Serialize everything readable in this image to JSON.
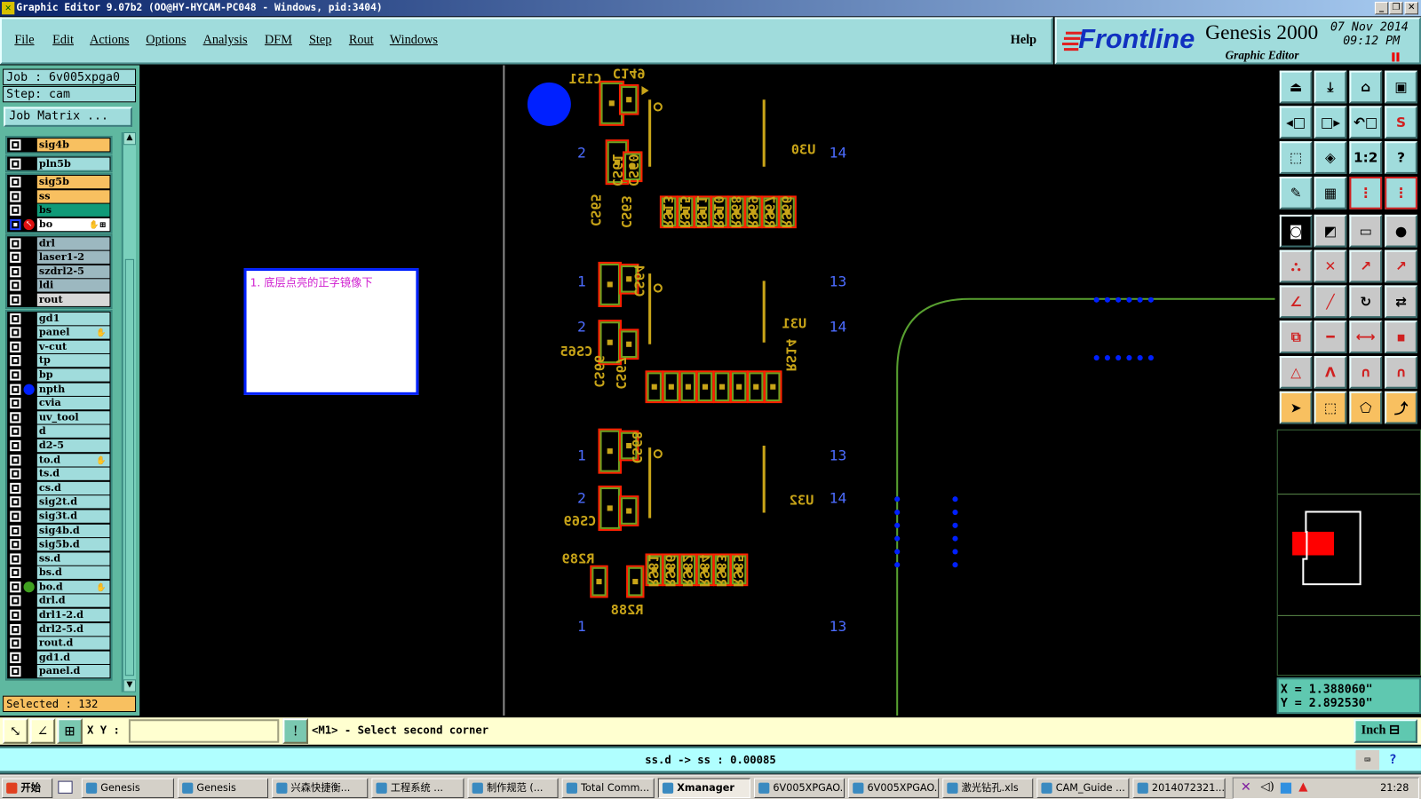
{
  "window": {
    "title": "Graphic Editor 9.07b2 (OO@HY-HYCAM-PC048 - Windows, pid:3404)",
    "min": "_",
    "max": "❐",
    "close": "✕"
  },
  "menu": {
    "items": [
      "File",
      "Edit",
      "Actions",
      "Options",
      "Analysis",
      "DFM",
      "Step",
      "Rout",
      "Windows"
    ],
    "help": "Help"
  },
  "brand": {
    "logo": "Frontline",
    "product": "Genesis 2000",
    "subtitle": "Graphic Editor",
    "date": "07 Nov 2014",
    "time": "09:12 PM"
  },
  "job": {
    "job": "Job  :  6v005xpga0",
    "step": "Step:  cam",
    "matrix_button": "Job Matrix ..."
  },
  "layer_groups": [
    [
      {
        "name": "sig4b",
        "color": "#f8c060"
      }
    ],
    [
      {
        "name": "pln5b",
        "color": "#a0dcdc"
      }
    ],
    [
      {
        "name": "sig5b",
        "color": "#f8c060"
      },
      {
        "name": "ss",
        "color": "#f8c060"
      },
      {
        "name": "bs",
        "color": "#109a78"
      },
      {
        "name": "bo",
        "color": "#ffffff",
        "work": true,
        "hand": "✋⊞"
      }
    ],
    [
      {
        "name": "drl",
        "color": "#9cb8c0"
      },
      {
        "name": "laser1-2",
        "color": "#9cb8c0"
      },
      {
        "name": "szdrl2-5",
        "color": "#9cb8c0"
      },
      {
        "name": "ldi",
        "color": "#9cb8c0"
      },
      {
        "name": "rout",
        "color": "#d8d8d8"
      }
    ],
    [
      {
        "name": "gd1",
        "color": "#a0dcdc"
      },
      {
        "name": "panel",
        "color": "#a0dcdc",
        "hand": "✋"
      },
      {
        "name": "v-cut",
        "color": "#a0dcdc"
      },
      {
        "name": "tp",
        "color": "#a0dcdc"
      },
      {
        "name": "bp",
        "color": "#a0dcdc"
      },
      {
        "name": "npth",
        "color": "#a0dcdc",
        "marker": "#0020ff"
      },
      {
        "name": "cvia",
        "color": "#a0dcdc"
      },
      {
        "name": "uv_tool",
        "color": "#a0dcdc"
      },
      {
        "name": "d",
        "color": "#a0dcdc"
      },
      {
        "name": "d2-5",
        "color": "#a0dcdc"
      },
      {
        "name": "to.d",
        "color": "#a0dcdc",
        "hand": "✋"
      },
      {
        "name": "ts.d",
        "color": "#a0dcdc"
      },
      {
        "name": "cs.d",
        "color": "#a0dcdc"
      },
      {
        "name": "sig2t.d",
        "color": "#a0dcdc"
      },
      {
        "name": "sig3t.d",
        "color": "#a0dcdc"
      },
      {
        "name": "sig4b.d",
        "color": "#a0dcdc"
      },
      {
        "name": "sig5b.d",
        "color": "#a0dcdc"
      },
      {
        "name": "ss.d",
        "color": "#a0dcdc"
      },
      {
        "name": "bs.d",
        "color": "#a0dcdc"
      },
      {
        "name": "bo.d",
        "color": "#a0dcdc",
        "marker": "#40a020",
        "hand": "✋"
      },
      {
        "name": "drl.d",
        "color": "#a0dcdc"
      },
      {
        "name": "drl1-2.d",
        "color": "#a0dcdc"
      },
      {
        "name": "drl2-5.d",
        "color": "#a0dcdc"
      },
      {
        "name": "rout.d",
        "color": "#a0dcdc"
      },
      {
        "name": "gd1.d",
        "color": "#a0dcdc"
      },
      {
        "name": "panel.d",
        "color": "#a0dcdc"
      }
    ]
  ],
  "selected": "Selected : 132",
  "note": "1. 底层点亮的正字镜像下",
  "pcb_labels": {
    "c151": "C151",
    "c149": "C149",
    "u30": "U30",
    "u31": "U31",
    "u32": "U32",
    "cs61": "CS61",
    "cs60": "CS60",
    "cs65": "CS65",
    "cs63": "CS63",
    "cs64": "CS64",
    "cs65b": "CS65",
    "cs66": "CS66",
    "cs67": "CS67",
    "cs68": "CS68",
    "cs69": "CS69",
    "rs_top": [
      "RS13",
      "RS15",
      "RS11",
      "RS10",
      "RS68",
      "RS69",
      "RS67",
      "RS66"
    ],
    "rs14": "RS14",
    "r289": "R289",
    "r288": "R288",
    "rs_bot": [
      "RS81",
      "RS86",
      "RS82",
      "RS84",
      "RS83",
      "RS85"
    ],
    "pins": {
      "p2a": "2",
      "p14a": "14",
      "p1b": "1",
      "p13b": "13",
      "p2b": "2",
      "p14b": "14",
      "p1c": "1",
      "p13c": "13",
      "p2c": "2",
      "p14c": "14",
      "p1d": "1",
      "p13d": "13"
    }
  },
  "colors": {
    "pcb_yellow": "#c8a418",
    "pad_red": "#ff2000",
    "pad_green": "#70a020",
    "route_green": "#58a030",
    "blue": "#0020ff"
  },
  "toolbar": [
    "open-step-icon",
    "save-step-icon",
    "home-icon",
    "window-icon",
    "pan-left-icon",
    "pan-right-icon",
    "undo-view-icon",
    "redraw-icon",
    "zoom-fit-icon",
    "zoom-center-icon",
    "scale-1-2-icon",
    "help-icon",
    "tools-palette-icon",
    "grid-icon",
    "netlist-icon",
    "netlist-alt-icon",
    "snap-pad-icon",
    "measure-icon",
    "ruler-icon",
    "select-pad-icon",
    "connect-icon",
    "delete-icon",
    "move-point-icon",
    "move-point-alt-icon",
    "draw-line-icon",
    "draw-line-alt-icon",
    "rotate-icon",
    "flip-icon",
    "copy-icon",
    "line-icon",
    "dimension-icon",
    "shape-icon",
    "arc-icon",
    "triangle-icon",
    "arch-icon",
    "arch-alt-icon",
    "select-icon",
    "select-box-icon",
    "select-polygon-icon",
    "select-net-icon"
  ],
  "coords": {
    "x": "X = 1.388060\"",
    "y": "Y = 2.892530\""
  },
  "command": {
    "xy_label": "X Y :",
    "xy_value": "",
    "prompt": "<M1> - Select second corner",
    "units": "Inch"
  },
  "status": "ss.d -> ss : 0.00085",
  "taskbar": {
    "start": "开始",
    "items": [
      "Genesis",
      "Genesis",
      "兴森快捷衡...",
      "工程系统 ...",
      "制作规范 (...",
      "Total Comm...",
      "Xmanager",
      "6V005XPGAO...",
      "6V005XPGAO...",
      "激光钻孔.xls",
      "CAM_Guide ...",
      "2014072321..."
    ],
    "clock": "21:28"
  }
}
